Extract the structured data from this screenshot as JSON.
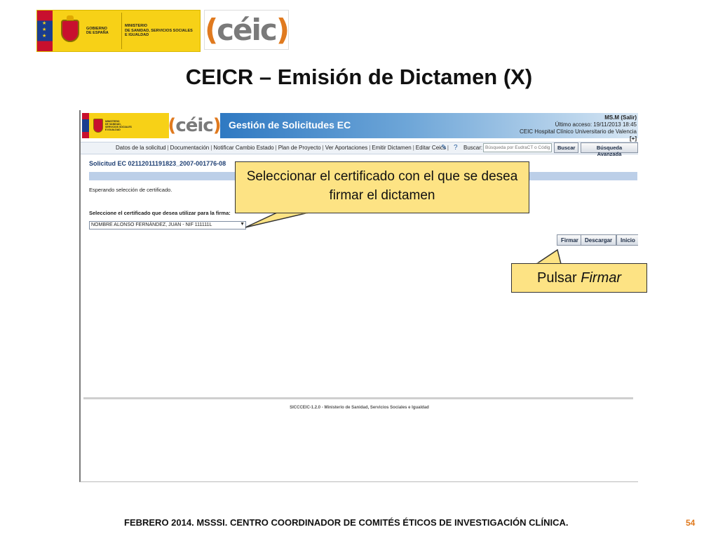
{
  "slide": {
    "title": "CEICR – Emisión de Dictamen (X)",
    "footer": "FEBRERO 2014. MSSSI. CENTRO COORDINADOR DE COMITÉS ÉTICOS DE INVESTIGACIÓN CLÍNICA.",
    "page_number": "54",
    "logo_gobierno": "GOBIERNO\nDE ESPAÑA",
    "logo_ministerio": "MINISTERIO\nDE SANIDAD, SERVICIOS SOCIALES\nE IGUALDAD",
    "logo_ceic": "céic"
  },
  "app": {
    "title": "Gestión de Solicitudes EC",
    "user": "MS.M",
    "logout": "(Salir)",
    "last_access": "Último acceso: 19/11/2013 18:45",
    "organization": "CEIC Hospital Clínico Universitario de Valencia",
    "expand": "[+]",
    "nav_items": [
      "Datos de la solicitud",
      "Documentación",
      "Notificar Cambio Estado",
      "Plan de Proyecto",
      "Ver Aportaciones",
      "Emitir Dictamen",
      "Editar Ceics"
    ],
    "search_label": "Buscar:",
    "search_placeholder": "Búsqueda por EudraCT o Código",
    "search_button": "Buscar",
    "advanced_search_button": "Búsqueda Avanzada",
    "solicitud_title": "Solicitud EC 02112011191823_2007-001776-08",
    "status_text": "Esperando selección de certificado.",
    "select_label": "Seleccione el certificado que desea utilizar para la firma:",
    "selected_certificate": "NOMBRE ALONSO FERNÁNDEZ, JUAN - NIF 111111L",
    "buttons": {
      "sign": "Firmar",
      "download": "Descargar",
      "home": "Inicio"
    },
    "footer": "SICCCEIC-1.2.0 - Ministerio de Sanidad, Servicios Sociales e Igualdad"
  },
  "callouts": {
    "select_certificate": "Seleccionar el certificado con el que se desea firmar el dictamen",
    "press_prefix": "Pulsar",
    "press_action": "Firmar"
  },
  "colors": {
    "callout_bg": "#fde384",
    "banner_blue": "#2f79c2",
    "accent_orange": "#e07a1f"
  }
}
